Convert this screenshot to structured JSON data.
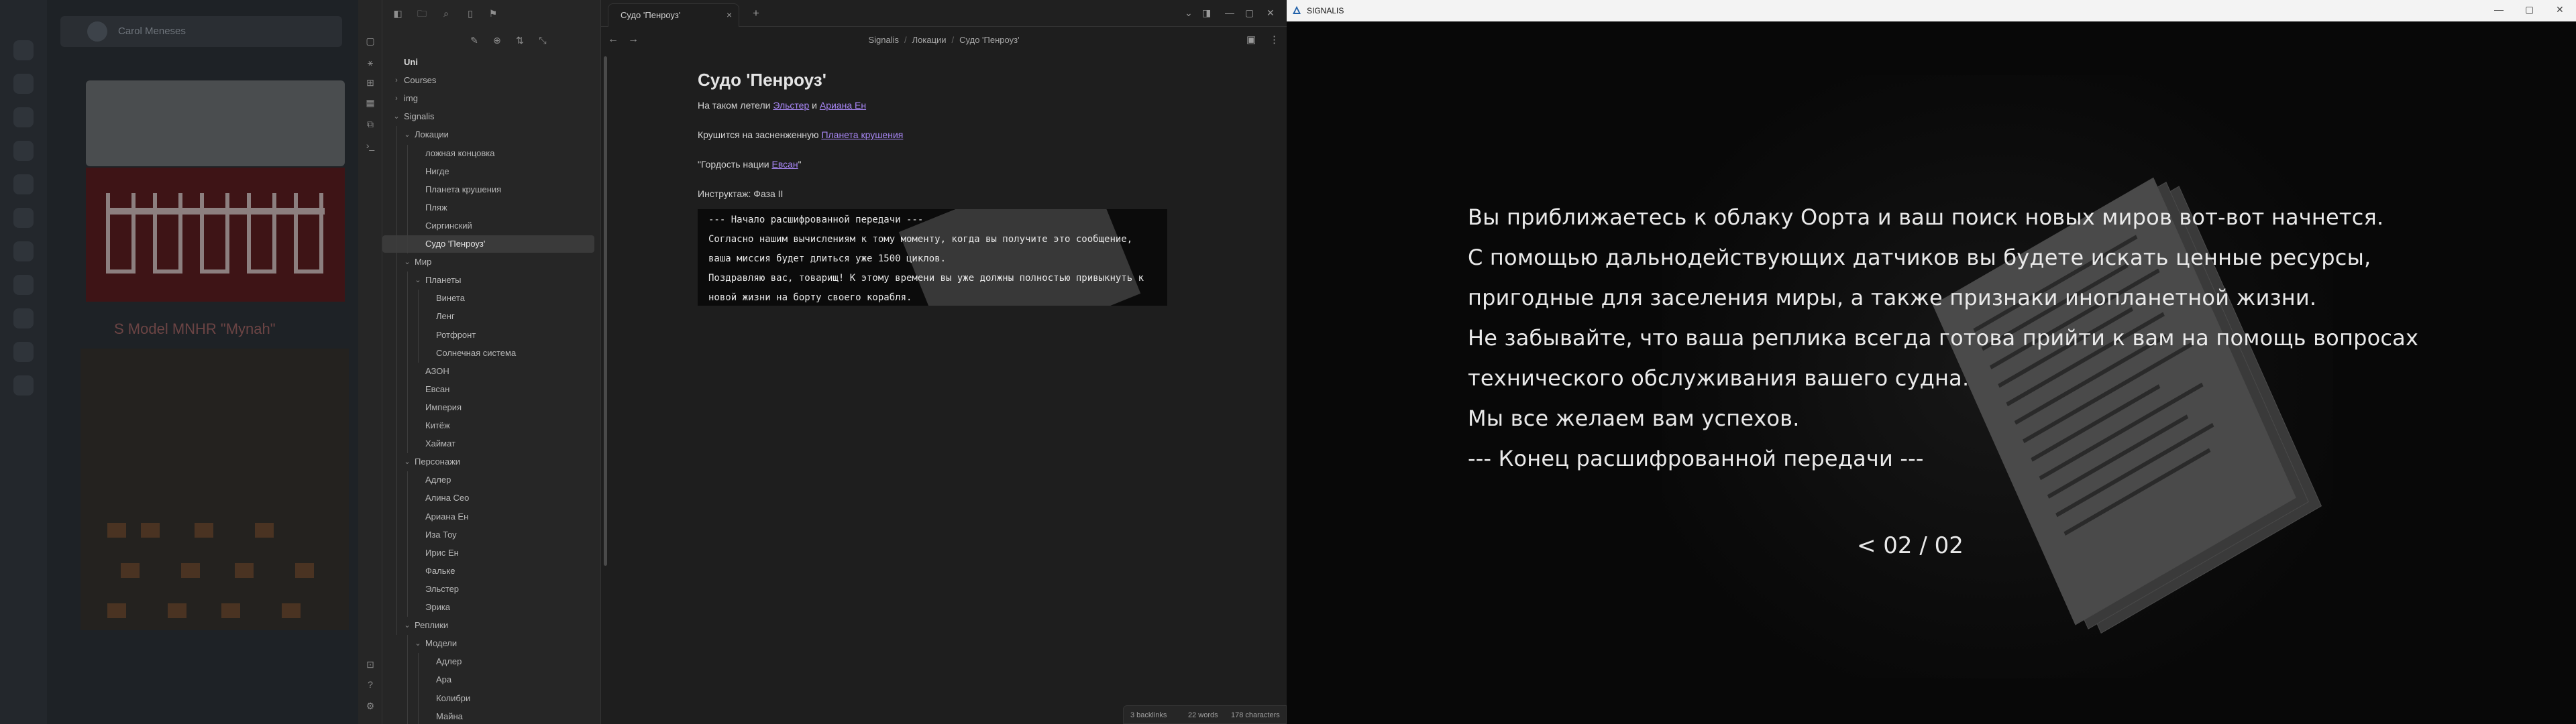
{
  "background_app": {
    "header_name": "Carol Meneses",
    "model_caption": "S Model MNHR \"Mynah\""
  },
  "obsidian": {
    "vault_name": "Uni",
    "tab_title": "Судо 'Пенроуз'",
    "breadcrumb": [
      "Signalis",
      "Локации",
      "Судо 'Пенроуз'"
    ],
    "tree": [
      {
        "label": "Uni",
        "depth": 0,
        "chev": ""
      },
      {
        "label": "Courses",
        "depth": 0,
        "chev": "›"
      },
      {
        "label": "img",
        "depth": 0,
        "chev": "›"
      },
      {
        "label": "Signalis",
        "depth": 0,
        "chev": "⌄"
      },
      {
        "label": "Локации",
        "depth": 1,
        "chev": "⌄"
      },
      {
        "label": "ложная концовка",
        "depth": 2,
        "chev": ""
      },
      {
        "label": "Нигде",
        "depth": 2,
        "chev": ""
      },
      {
        "label": "Планета крушения",
        "depth": 2,
        "chev": ""
      },
      {
        "label": "Пляж",
        "depth": 2,
        "chev": ""
      },
      {
        "label": "Сиргинский",
        "depth": 2,
        "chev": ""
      },
      {
        "label": "Судо 'Пенроуз'",
        "depth": 2,
        "chev": "",
        "active": true
      },
      {
        "label": "Мир",
        "depth": 1,
        "chev": "⌄"
      },
      {
        "label": "Планеты",
        "depth": 2,
        "chev": "⌄"
      },
      {
        "label": "Винета",
        "depth": 3,
        "chev": ""
      },
      {
        "label": "Ленг",
        "depth": 3,
        "chev": ""
      },
      {
        "label": "Ротфронт",
        "depth": 3,
        "chev": ""
      },
      {
        "label": "Солнечная система",
        "depth": 3,
        "chev": ""
      },
      {
        "label": "АЗОН",
        "depth": 2,
        "chev": ""
      },
      {
        "label": "Евсан",
        "depth": 2,
        "chev": ""
      },
      {
        "label": "Империя",
        "depth": 2,
        "chev": ""
      },
      {
        "label": "Китёж",
        "depth": 2,
        "chev": ""
      },
      {
        "label": "Хаймат",
        "depth": 2,
        "chev": ""
      },
      {
        "label": "Персонажи",
        "depth": 1,
        "chev": "⌄"
      },
      {
        "label": "Адлер",
        "depth": 2,
        "chev": ""
      },
      {
        "label": "Алина Сео",
        "depth": 2,
        "chev": ""
      },
      {
        "label": "Ариана Ен",
        "depth": 2,
        "chev": ""
      },
      {
        "label": "Иза Тоу",
        "depth": 2,
        "chev": ""
      },
      {
        "label": "Ирис Ен",
        "depth": 2,
        "chev": ""
      },
      {
        "label": "Фальке",
        "depth": 2,
        "chev": ""
      },
      {
        "label": "Эльстер",
        "depth": 2,
        "chev": ""
      },
      {
        "label": "Эрика",
        "depth": 2,
        "chev": ""
      },
      {
        "label": "Реплики",
        "depth": 1,
        "chev": "⌄"
      },
      {
        "label": "Модели",
        "depth": 2,
        "chev": "⌄"
      },
      {
        "label": "Адлер",
        "depth": 3,
        "chev": ""
      },
      {
        "label": "Ара",
        "depth": 3,
        "chev": ""
      },
      {
        "label": "Колибри",
        "depth": 3,
        "chev": ""
      },
      {
        "label": "Майна",
        "depth": 3,
        "chev": ""
      }
    ],
    "note": {
      "title": "Судо 'Пенроуз'",
      "p1_prefix": "На таком летели ",
      "p1_link1": "Эльстер",
      "p1_mid": " и ",
      "p1_link2": "Ариана Ен",
      "p2_prefix": "Крушится на засненженную ",
      "p2_link": "Планета крушения",
      "p3_prefix": "\"Гордость нации ",
      "p3_link": "Евсан",
      "p3_suffix": "\"",
      "p4": "Инструктаж: Фаза II",
      "image_lines": [
        "--- Начало расшифрованной передачи ---",
        "Согласно нашим вычислениям к тому моменту, когда вы получите это сообщение,",
        "ваша миссия будет длиться уже 1500 циклов.",
        "Поздравляю вас, товарищ! К этому времени вы уже должны полностью привыкнуть к",
        "новой жизни на борту своего корабля."
      ]
    },
    "status": {
      "backlinks": "3 backlinks",
      "words": "22 words",
      "characters": "178 characters"
    }
  },
  "game": {
    "window_title": "SIGNALIS",
    "lines": [
      "Вы приближаетесь к облаку Оорта и ваш поиск новых миров вот-вот начнется.",
      "С помощью дальнодействующих датчиков вы будете искать ценные ресурсы,",
      "пригодные для заселения миры, а также признаки инопланетной жизни.",
      "Не забывайте, что ваша реплика всегда готова прийти к вам на помощь вопросах",
      "технического обслуживания вашего судна.",
      "Мы все желаем вам успехов.",
      "--- Конец расшифрованной передачи ---"
    ],
    "pager": "< 02 / 02"
  }
}
